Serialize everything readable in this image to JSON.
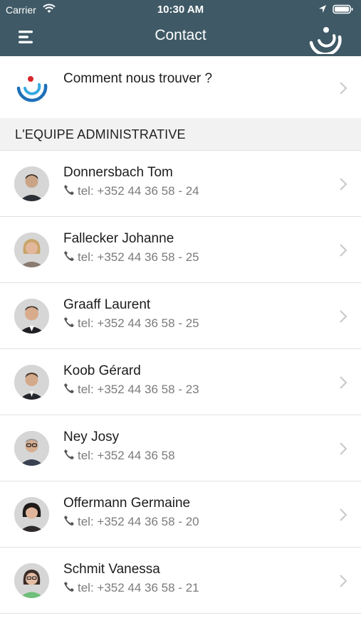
{
  "status_bar": {
    "carrier": "Carrier",
    "time": "10:30 AM"
  },
  "nav": {
    "title": "Contact",
    "menu_icon": "hamburger-menu-icon",
    "logo_icon": "logo-icon"
  },
  "location_item": {
    "label": "Comment nous trouver ?",
    "icon": "logo-icon"
  },
  "section": {
    "title": "L'EQUIPE ADMINISTRATIVE"
  },
  "contacts": [
    {
      "name": "Donnersbach Tom",
      "tel": "tel: +352 44 36 58 - 24"
    },
    {
      "name": "Fallecker Johanne",
      "tel": "tel: +352 44 36 58 - 25"
    },
    {
      "name": "Graaff Laurent",
      "tel": "tel: +352 44 36 58 - 25"
    },
    {
      "name": "Koob Gérard",
      "tel": "tel: +352 44 36 58 - 23"
    },
    {
      "name": "Ney Josy",
      "tel": "tel: +352 44 36 58"
    },
    {
      "name": "Offermann Germaine",
      "tel": "tel: +352 44 36 58 - 20"
    },
    {
      "name": "Schmit Vanessa",
      "tel": "tel: +352 44 36 58 - 21"
    }
  ],
  "colors": {
    "header": "#3f5966",
    "brand_red": "#d9262b",
    "brand_blue": "#1f6fb8",
    "brand_cyan": "#36a9e0"
  }
}
